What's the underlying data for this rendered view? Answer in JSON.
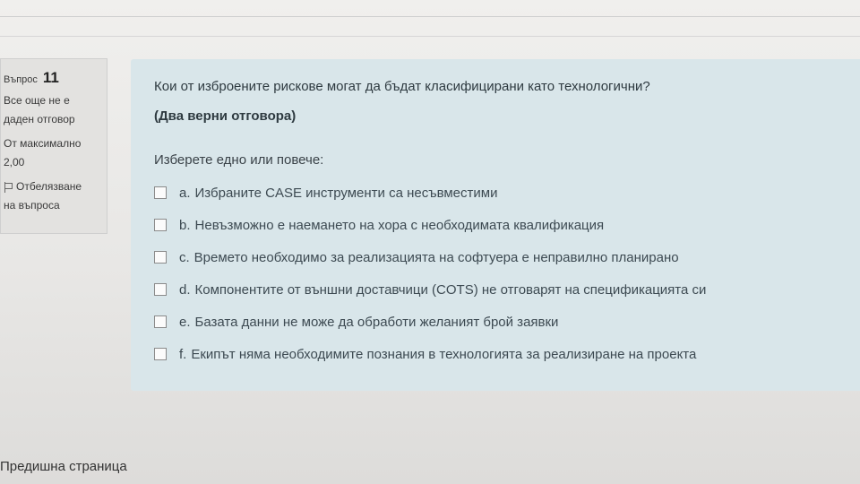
{
  "question_info": {
    "label": "Въпрос",
    "number": "11",
    "state_line1": "Все още не е",
    "state_line2": "даден отговор",
    "grade_line1": "От максимално",
    "grade_line2": "2,00",
    "flag_label_line1": "Отбелязване",
    "flag_label_line2": "на въпроса",
    "flag_icon": "flag-icon"
  },
  "question": {
    "text": "Кои от изброените рискове могат да бъдат класифицирани като технологични?",
    "hint": "(Два верни отговора)",
    "prompt": "Изберете едно или повече:",
    "answers": [
      {
        "letter": "a.",
        "text": "Избраните CASE инструменти са несъвместими",
        "checked": false
      },
      {
        "letter": "b.",
        "text": "Невъзможно е наемането на хора с необходимата квалификация",
        "checked": false
      },
      {
        "letter": "c.",
        "text": "Времето необходимо за реализацията на софтуера е неправилно планирано",
        "checked": false
      },
      {
        "letter": "d.",
        "text": "Компонентите от външни доставчици (COTS) не отговарят на спецификацията си",
        "checked": false
      },
      {
        "letter": "e.",
        "text": "Базата данни не може да обработи желаният брой заявки",
        "checked": false
      },
      {
        "letter": "f.",
        "text": "Екипът няма необходимите познания в технологията за реализиране на проекта",
        "checked": false
      }
    ]
  },
  "navigation": {
    "previous_page": "Предишна страница"
  }
}
